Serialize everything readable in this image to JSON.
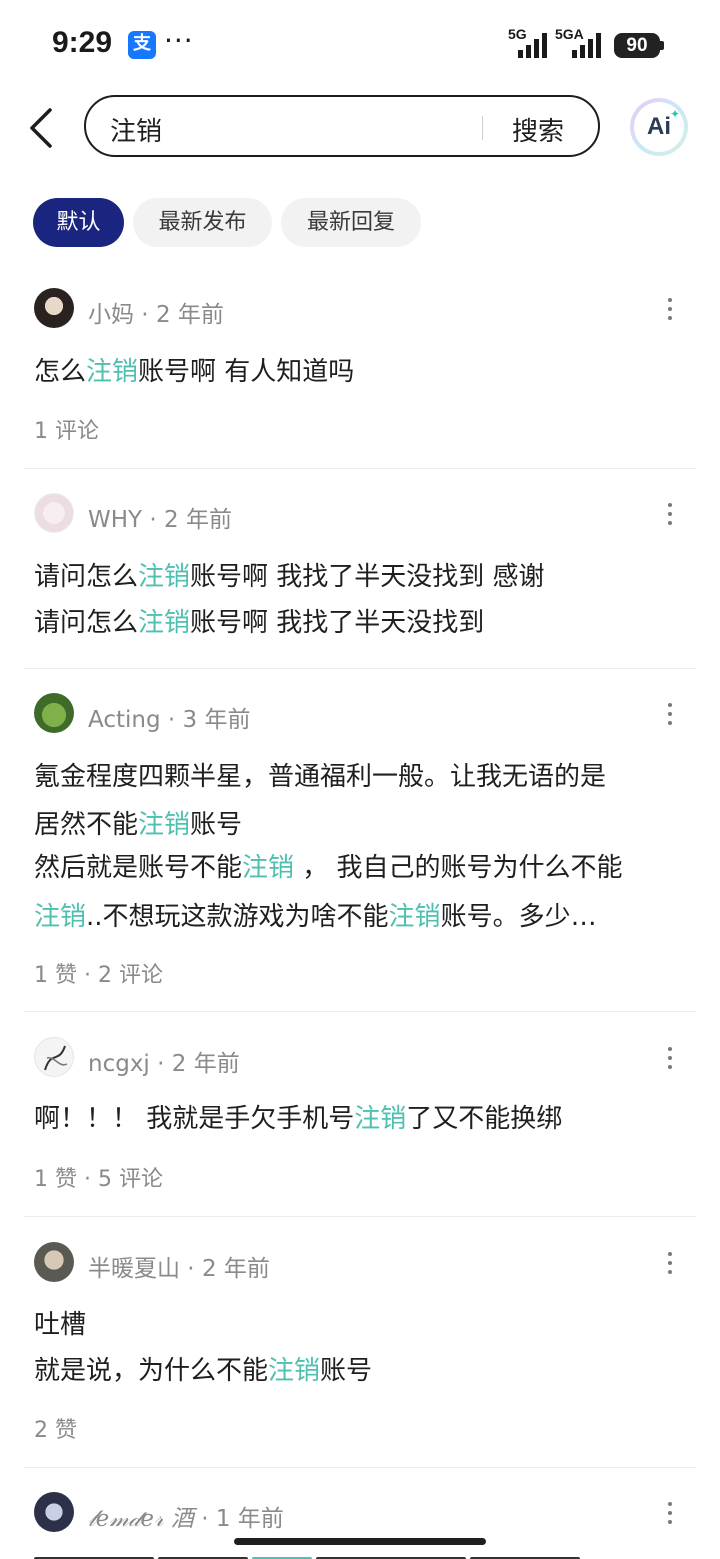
{
  "status": {
    "time": "9:29",
    "app_icon_glyph": "支",
    "dots": "···",
    "net1": "5G",
    "net2": "5GA",
    "battery": "90"
  },
  "search": {
    "query": "注销",
    "button": "搜索",
    "ai_label": "Ai",
    "ai_spark": "✦"
  },
  "filters": [
    "默认",
    "最新发布",
    "最新回复"
  ],
  "posts": [
    {
      "author": "小妈",
      "time": "2 年前",
      "lines": [
        [
          "怎么",
          "注销",
          "账号啊 有人知道吗"
        ]
      ],
      "stats": "1 评论"
    },
    {
      "author": "WHY",
      "time": "2 年前",
      "lines": [
        [
          "请问怎么",
          "注销",
          "账号啊 我找了半天没找到 感谢"
        ],
        [
          "请问怎么",
          "注销",
          "账号啊 我找了半天没找到"
        ]
      ],
      "stats": ""
    },
    {
      "author": "Acting",
      "time": "3 年前",
      "lines": [
        [
          "氪金程度四颗半星，普通福利一般。让我无语的是"
        ],
        [
          "居然不能",
          "注销",
          "账号"
        ],
        [
          "然后就是账号不能",
          "注销",
          " ， 我自己的账号为什么不能"
        ],
        [
          "",
          "注销",
          "..不想玩这款游戏为啥不能",
          "注销",
          "账号。多少…"
        ]
      ],
      "stats": "1 赞 · 2 评论"
    },
    {
      "author": "ncgxj",
      "time": "2 年前",
      "lines": [
        [
          "啊！！！ 我就是手欠手机号",
          "注销",
          "了又不能换绑"
        ]
      ],
      "stats": "1 赞 · 5 评论"
    },
    {
      "author": "半暖夏山",
      "time": "2 年前",
      "lines": [
        [
          "吐槽"
        ],
        [
          "就是说，为什么不能",
          "注销",
          "账号"
        ]
      ],
      "stats": "2 赞"
    },
    {
      "author": "𝓁𝑒𝓂𝒹𝑒𝓇 酒",
      "time": "1 年前",
      "lines": [],
      "stats": ""
    }
  ],
  "colors": {
    "highlight": "#4fc0b0",
    "active_filter": "#1a2580"
  },
  "icons": [
    "back-arrow-icon",
    "more-vertical-icon",
    "ai-assistant-icon",
    "signal-icon",
    "battery-icon"
  ]
}
